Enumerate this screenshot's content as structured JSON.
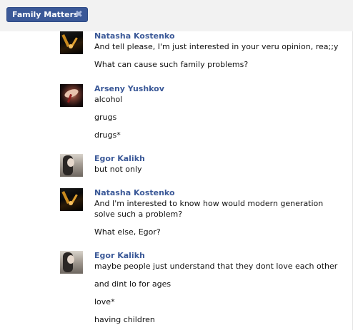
{
  "tab": {
    "title": "Family Matters",
    "close_glyph": "✖",
    "close_icon": "close-icon"
  },
  "colors": {
    "accent": "#3b5998",
    "tab_bg": "#3b5998",
    "author": "#3b5998"
  },
  "messages": [
    {
      "author": "Natasha Kostenko",
      "avatar": "natasha",
      "lines": [
        "And tell please, I'm just interested in your veru opinion, rea;;y",
        "What can cause such family problems?"
      ]
    },
    {
      "author": "Arseny Yushkov",
      "avatar": "arseny",
      "lines": [
        "alcohol",
        "grugs",
        "drugs*"
      ]
    },
    {
      "author": "Egor Kalikh",
      "avatar": "egor",
      "lines": [
        "but not only"
      ]
    },
    {
      "author": "Natasha Kostenko",
      "avatar": "natasha",
      "lines": [
        "And I'm interested to know how would modern generation solve such a problem?",
        "What else, Egor?"
      ]
    },
    {
      "author": "Egor Kalikh",
      "avatar": "egor",
      "lines": [
        "maybe people just understand that they dont love each other",
        "and dint lo for ages",
        "love*",
        "having children"
      ]
    }
  ]
}
